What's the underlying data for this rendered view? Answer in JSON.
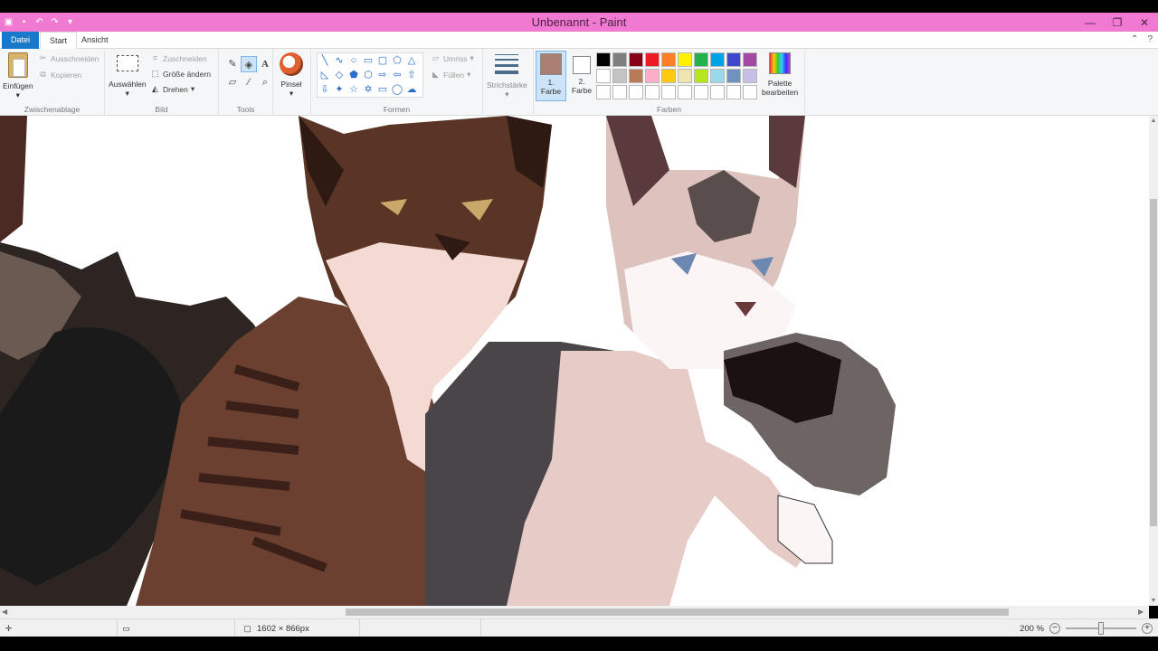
{
  "window": {
    "title": "Unbenannt - Paint",
    "minimize_icon": "minimize-icon",
    "maximize_icon": "maximize-icon",
    "close_icon": "close-icon"
  },
  "quick_access": [
    "save-icon",
    "undo-icon",
    "redo-icon",
    "customize-qat-icon"
  ],
  "tabs": {
    "file": "Datei",
    "home": "Start",
    "view": "Ansicht"
  },
  "ribbon": {
    "clipboard": {
      "label": "Zwischenablage",
      "paste": "Einfügen",
      "cut": "Ausschneiden",
      "copy": "Kopieren"
    },
    "image": {
      "label": "Bild",
      "select": "Auswählen",
      "crop": "Zuschneiden",
      "resize": "Größe ändern",
      "rotate": "Drehen"
    },
    "tools": {
      "label": "Tools",
      "items": [
        "pencil-icon",
        "fill-icon",
        "text-icon",
        "eraser-icon",
        "color-picker-icon",
        "magnifier-icon"
      ],
      "active": "fill-icon"
    },
    "brushes": {
      "label": "Pinsel"
    },
    "shapes": {
      "label": "Formen",
      "outline": "Umriss",
      "fill": "Füllen"
    },
    "size": {
      "label": "Strichstärke"
    },
    "colors": {
      "label": "Farben",
      "color1_line1": "1.",
      "color1_line2": "Farbe",
      "color2_line1": "2.",
      "color2_line2": "Farbe",
      "color1": "#a97f71",
      "color2": "#ffffff",
      "edit_line1": "Palette",
      "edit_line2": "bearbeiten",
      "palette_row1": [
        "#000000",
        "#7f7f7f",
        "#880015",
        "#ed1c24",
        "#ff7f27",
        "#fff200",
        "#22b14c",
        "#00a2e8",
        "#3f48cc",
        "#a349a4"
      ],
      "palette_row2": [
        "#ffffff",
        "#c3c3c3",
        "#b97a57",
        "#ffaec9",
        "#ffc90e",
        "#efe4b0",
        "#b5e61d",
        "#99d9ea",
        "#7092be",
        "#c8bfe7"
      ],
      "palette_row3": [
        "#ffffff",
        "#ffffff",
        "#ffffff",
        "#ffffff",
        "#ffffff",
        "#ffffff",
        "#ffffff",
        "#ffffff",
        "#ffffff",
        "#ffffff"
      ]
    }
  },
  "statusbar": {
    "image_size": "1602 × 866px",
    "zoom": "200 %",
    "zoom_level": 0.5
  },
  "canvas": {
    "artwork": "drawing-canvas"
  }
}
